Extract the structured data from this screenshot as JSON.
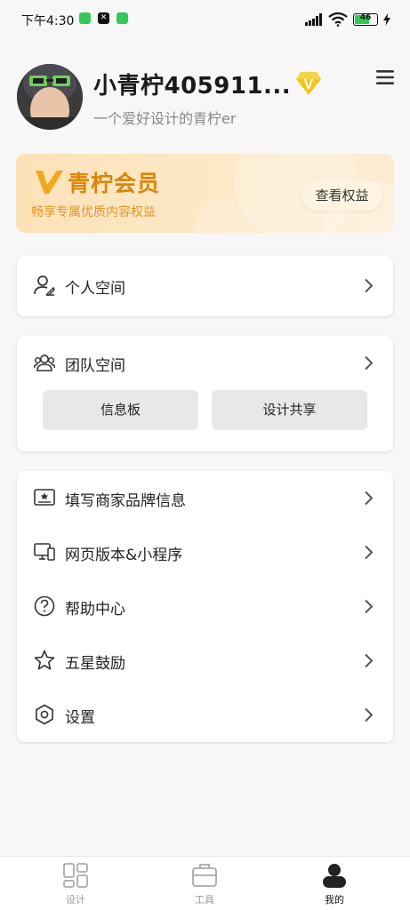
{
  "status_bar": {
    "time": "下午4:30",
    "battery": "46",
    "app_icons": [
      "wechat-icon",
      "capcut-icon",
      "wechat-icon"
    ]
  },
  "profile": {
    "username": "小青柠405911...",
    "bio": "一个爱好设计的青柠er",
    "vip_badge_letter": "V"
  },
  "vip_banner": {
    "logo_letter": "V",
    "title": "青柠会员",
    "subtitle": "畅享专属优质内容权益",
    "button_label": "查看权益"
  },
  "personal_space": {
    "label": "个人空间",
    "icon": "person-edit-icon"
  },
  "team_space": {
    "label": "团队空间",
    "icon": "team-icon",
    "buttons": [
      "信息板",
      "设计共享"
    ]
  },
  "menu": {
    "items": [
      {
        "label": "填写商家品牌信息",
        "icon": "id-card-icon"
      },
      {
        "label": "网页版本&小程序",
        "icon": "monitor-icon"
      },
      {
        "label": "帮助中心",
        "icon": "help-icon"
      },
      {
        "label": "五星鼓励",
        "icon": "star-icon"
      },
      {
        "label": "设置",
        "icon": "settings-icon"
      }
    ]
  },
  "bottom_nav": {
    "items": [
      {
        "label": "设计",
        "icon": "grid-icon",
        "active": false
      },
      {
        "label": "工具",
        "icon": "briefcase-icon",
        "active": false
      },
      {
        "label": "我的",
        "icon": "profile-icon",
        "active": true
      }
    ]
  },
  "colors": {
    "accent_gold": "#d8860a",
    "vip_badge": "#f5c518",
    "banner_bg": "#fde2b8",
    "battery_green": "#34c759"
  }
}
